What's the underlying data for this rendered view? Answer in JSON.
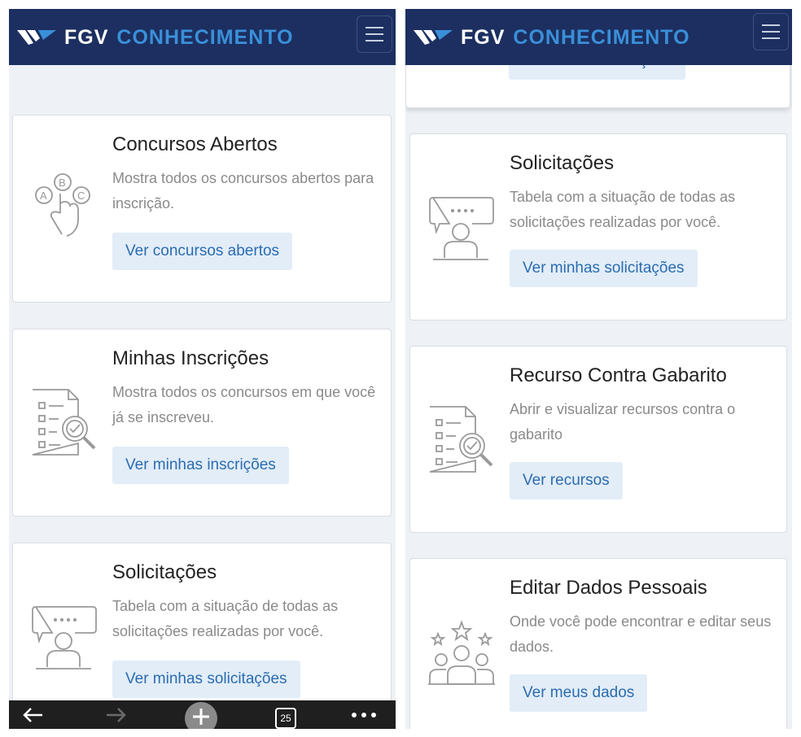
{
  "header": {
    "brand": "FGV",
    "product": "CONHECIMENTO",
    "menu_icon": "hamburger-menu-icon"
  },
  "left": {
    "cards": [
      {
        "title": "Concursos Abertos",
        "description": "Mostra todos os concursos abertos para inscrição.",
        "button": "Ver concursos abertos",
        "icon": "abc-choice-hand-icon"
      },
      {
        "title": "Minhas Inscrições",
        "description": "Mostra todos os concursos em que você já se inscreveu.",
        "button": "Ver minhas inscrições",
        "icon": "document-check-magnifier-icon"
      },
      {
        "title": "Solicitações",
        "description": "Tabela com a situação de todas as solicitações realizadas por você.",
        "button": "Ver minhas solicitações",
        "icon": "person-speech-bubble-icon"
      }
    ],
    "browser_bar": {
      "back_icon": "arrow-left-icon",
      "forward_icon": "arrow-right-icon",
      "new_tab_icon": "plus-circle-icon",
      "tab_count": "25",
      "more_icon": "more-dots-icon"
    }
  },
  "right": {
    "partial_button": "Ver minhas inscrições",
    "cards": [
      {
        "title": "Solicitações",
        "description": "Tabela com a situação de todas as solicitações realizadas por você.",
        "button": "Ver minhas solicitações",
        "icon": "person-speech-bubble-icon"
      },
      {
        "title": "Recurso Contra Gabarito",
        "description": "Abrir e visualizar recursos contra o gabarito",
        "button": "Ver recursos",
        "icon": "document-check-magnifier-icon"
      },
      {
        "title": "Editar Dados Pessoais",
        "description": "Onde você pode encontrar e editar seus dados.",
        "button": "Ver meus dados",
        "icon": "group-stars-icon"
      }
    ]
  },
  "colors": {
    "header_bg": "#1c2f60",
    "brand_accent": "#3a8fd9",
    "button_bg": "#e2edf8",
    "button_text": "#2b6cb0"
  }
}
